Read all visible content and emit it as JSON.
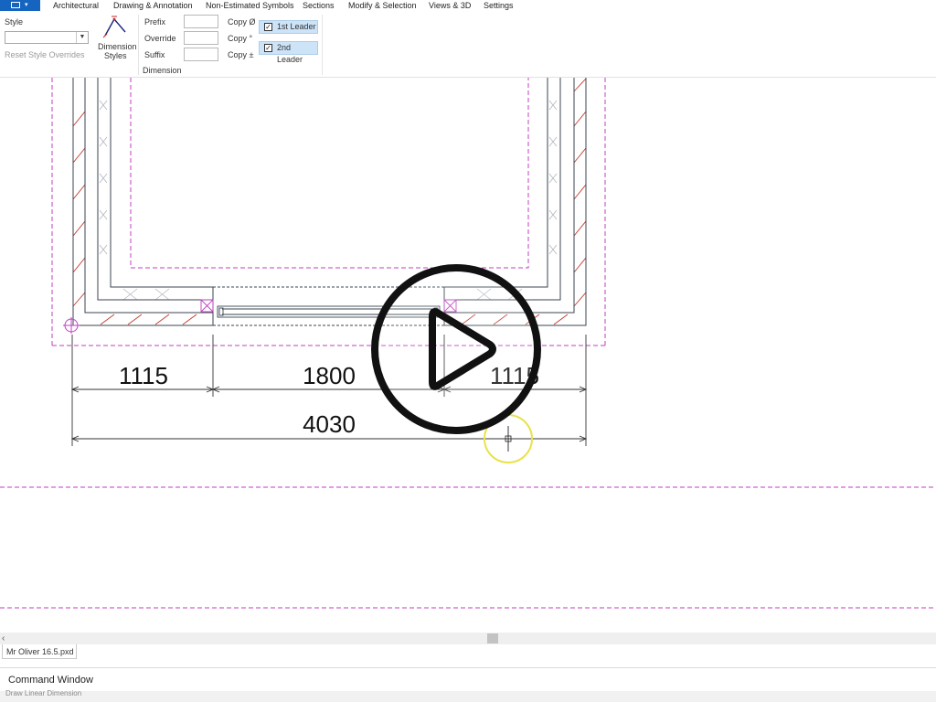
{
  "menu": {
    "items": [
      "Architectural",
      "Drawing & Annotation",
      "Non-Estimated Symbols",
      "Sections",
      "Modify & Selection",
      "Views & 3D",
      "Settings"
    ]
  },
  "ribbon": {
    "style_label": "Style",
    "style_value": "",
    "reset_label": "Reset Style Overrides",
    "dim_styles_label_1": "Dimension",
    "dim_styles_label_2": "Styles",
    "prefix_label": "Prefix",
    "override_label": "Override",
    "suffix_label": "Suffix",
    "prefix_value": "",
    "override_value": "",
    "suffix_value": "",
    "copy_diameter_label": "Copy Ø",
    "copy_degree_label": "Copy °",
    "copy_plusminus_label": "Copy ±",
    "leader1_label": "1st Leader",
    "leader2_label": "2nd Leader",
    "leader1_checked": true,
    "leader2_checked": true,
    "group_label": "Dimension"
  },
  "drawing": {
    "dimensions": [
      "1115",
      "1800",
      "1115",
      "4030"
    ]
  },
  "tabs": [
    "Mr Oliver 16.5.pxd"
  ],
  "command_window": {
    "title": "Command Window",
    "status": "Draw Linear Dimension"
  },
  "colors": {
    "accent": "#1565c0",
    "construction_line": "#c040c0",
    "hatch": "#c0392b",
    "wall_line": "#3a4550",
    "cursor_highlight": "#e8e24a"
  },
  "icons": {
    "play": "play-icon",
    "dimension_styles": "dimension-styles-icon",
    "origin": "origin-marker-icon",
    "cursor": "crosshair-cursor-icon"
  }
}
